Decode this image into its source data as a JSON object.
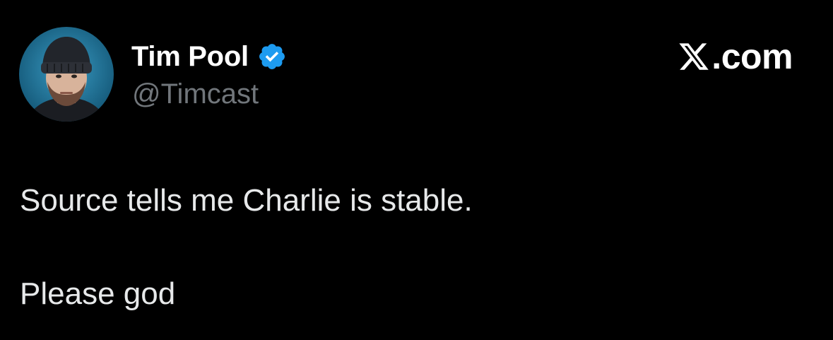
{
  "author": {
    "display_name": "Tim Pool",
    "handle": "@Timcast",
    "verified": true,
    "avatar_icon": "profile-avatar"
  },
  "brand": {
    "label": ".com",
    "icon": "x-logo-icon"
  },
  "tweet": {
    "lines": [
      "Source tells me Charlie is stable.",
      "Please god"
    ]
  },
  "colors": {
    "background": "#000000",
    "name": "#ffffff",
    "handle": "#71767b",
    "text": "#e7e9ea",
    "verified": "#1d9bf0"
  }
}
